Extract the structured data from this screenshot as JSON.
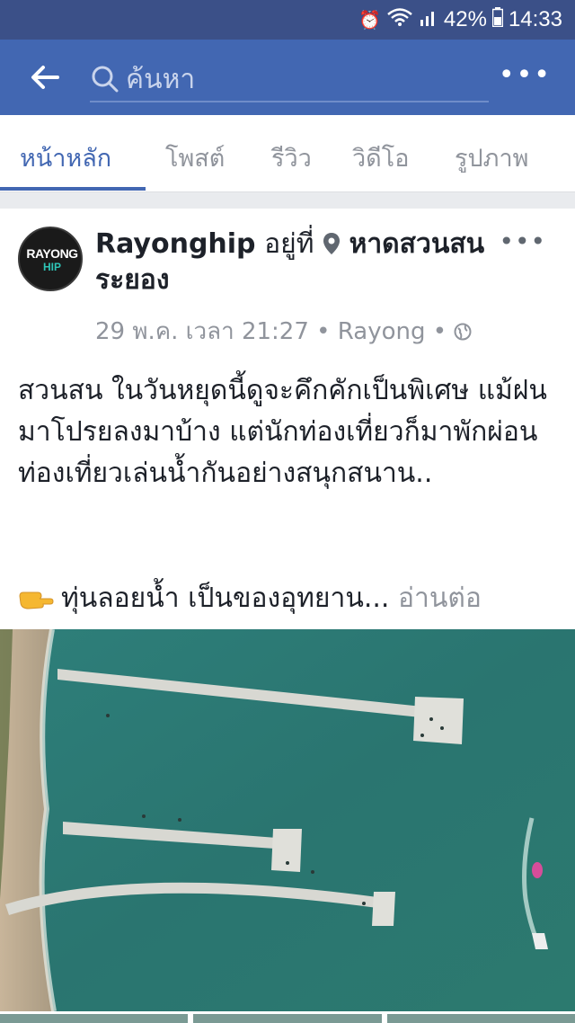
{
  "status_bar": {
    "battery": "42%",
    "time": "14:33",
    "icons": [
      "alarm-icon",
      "wifi-icon",
      "signal-icon",
      "battery-icon"
    ]
  },
  "app_bar": {
    "back_icon": "back-arrow-icon",
    "search_placeholder": "ค้นหา",
    "more_icon": "more-dots-icon",
    "color": "#4267b2"
  },
  "tabs": [
    {
      "label": "หน้าหลัก",
      "active": true
    },
    {
      "label": "โพสต์",
      "active": false
    },
    {
      "label": "รีวิว",
      "active": false
    },
    {
      "label": "วิดีโอ",
      "active": false
    },
    {
      "label": "รูปภาพ",
      "active": false
    }
  ],
  "post": {
    "avatar_text_top": "RAYONG",
    "avatar_text_bottom": "HIP",
    "author": "Rayonghip",
    "at_text": "อยู่ที่",
    "place": "หาดสวนสนระยอง",
    "date": "29 พ.ค. เวลา 21:27",
    "location": "Rayong",
    "privacy_icon": "globe-icon",
    "body": "สวนสน ในวันหยุดนี้ดูจะคึกคักเป็นพิเศษ แม้ฝนมาโปรยลงมาบ้าง แต่นักท่องเที่ยวก็มาพักผ่อน ท่องเที่ยวเล่นน้ำกันอย่างสนุกสนาน..",
    "preview": "ทุ่นลอยน้ำ เป็นของอุทยาน...",
    "read_more": "อ่านต่อ",
    "emoji_icon": "pointing-hand-icon",
    "photo": "aerial-beach-piers-image"
  }
}
